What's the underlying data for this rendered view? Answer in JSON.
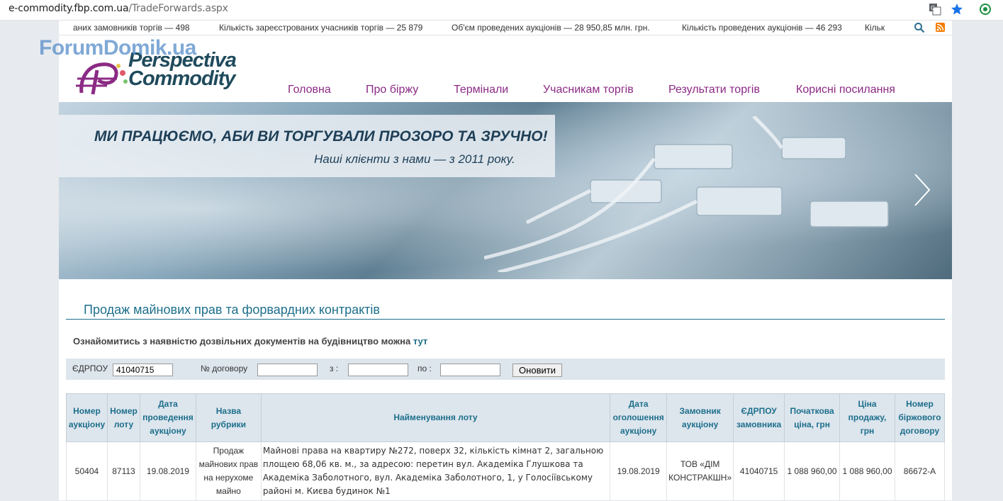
{
  "browser": {
    "url_host": "e-commodity.fbp.com.ua",
    "url_path": "/TradeForwards.aspx"
  },
  "ticker": {
    "item1": "аних замовників торгів — 498",
    "item2": "Кількість зареєстрованих учасників торгів — 25 879",
    "item3": "Об'єм проведених аукціонів — 28 950,85 млн. грн.",
    "item4": "Кількість проведених аукціонів — 46 293",
    "item5": "Кільк"
  },
  "watermark": "ForumDomik.ua",
  "logo": {
    "line1": "Perspectiva",
    "line2": "Commodity"
  },
  "nav": [
    "Головна",
    "Про біржу",
    "Термінали",
    "Учасникам торгів",
    "Результати торгів",
    "Корисні посилання"
  ],
  "banner": {
    "headline": "МИ ПРАЦЮЄМО, АБИ ВИ ТОРГУВАЛИ ПРОЗОРО ТА ЗРУЧНО!",
    "subline": "Наші клієнти з нами — з 2011 року."
  },
  "section": {
    "title": "Продаж майнових прав та форвардних контрактів",
    "note": "Ознайомитись з наявністю дозвільних документів на будівництво можна",
    "note_link": "тут"
  },
  "filter": {
    "edrpou_label": "ЄДРПОУ",
    "edrpou_value": "41040715",
    "contract_label": "№ договору",
    "from_label": "з :",
    "to_label": "по :",
    "update_button": "Оновити"
  },
  "table": {
    "headers": [
      "Номер аукціону",
      "Номер лоту",
      "Дата проведення аукціону",
      "Назва рубрики",
      "Найменування лоту",
      "Дата оголошення аукціону",
      "Замовник аукціону",
      "ЄДРПОУ замовника",
      "Початкова ціна, грн",
      "Ціна продажу, грн",
      "Номер біржового договору"
    ],
    "rows": [
      [
        "50404",
        "87113",
        "19.08.2019",
        "Продаж майнових прав на нерухоме майно",
        "Майнові права на квартиру №272, поверх 32, кількість кімнат 2, загальною площею 68,06 кв. м., за адресою: перетин вул. Академіка Глушкова та Академіка Заболотного, вул. Академіка Заболотного, 1, у Голосіївському районі м. Києва будинок №1",
        "19.08.2019",
        "ТОВ «ДІМ КОНСТРАКШН»",
        "41040715",
        "1 088 960,00",
        "1 088 960,00",
        "86672-А"
      ]
    ]
  }
}
